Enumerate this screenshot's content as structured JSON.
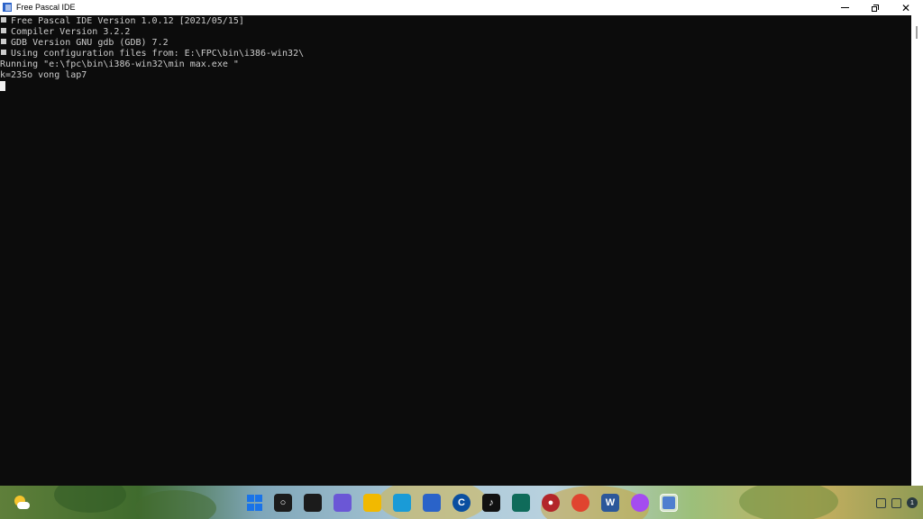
{
  "window": {
    "title": "Free Pascal IDE",
    "controls": {
      "minimize_icon": "minimize-icon",
      "restore_icon": "restore-icon",
      "close_icon": "close-icon",
      "close_glyph": "✕"
    }
  },
  "console": {
    "lines": [
      {
        "bullet": true,
        "text": "Free Pascal IDE Version 1.0.12 [2021/05/15]"
      },
      {
        "bullet": true,
        "text": "Compiler Version 3.2.2"
      },
      {
        "bullet": true,
        "text": "GDB Version GNU gdb (GDB) 7.2"
      },
      {
        "bullet": true,
        "text": "Using configuration files from: E:\\FPC\\bin\\i386-win32\\"
      },
      {
        "bullet": false,
        "text": "Running \"e:\\fpc\\bin\\i386-win32\\min max.exe \""
      },
      {
        "bullet": false,
        "text": "k=23So vong lap7"
      }
    ],
    "text_color": "#cccccc",
    "background_color": "#0c0c0c"
  },
  "taskbar": {
    "icons": [
      {
        "name": "weather-icon"
      },
      {
        "name": "start-icon",
        "color": "#1a73e8"
      },
      {
        "name": "search-icon",
        "color": "#1b1b1b",
        "glyph": "○"
      },
      {
        "name": "task-view-icon",
        "color": "#1b1b1b"
      },
      {
        "name": "meet-icon",
        "color": "#6b57d6"
      },
      {
        "name": "file-explorer-icon",
        "color": "#f2b900"
      },
      {
        "name": "edge-icon",
        "color": "#1a9bd7"
      },
      {
        "name": "store-icon",
        "color": "#2a63c9"
      },
      {
        "name": "cortana-icon",
        "color": "#0a4fa0",
        "glyph": "C"
      },
      {
        "name": "tiktok-icon",
        "color": "#111111",
        "glyph": "♪"
      },
      {
        "name": "app-icon",
        "color": "#0f6b5a"
      },
      {
        "name": "record-icon",
        "color": "#b3262a",
        "glyph": "●"
      },
      {
        "name": "chrome-icon",
        "color": "#e0442f"
      },
      {
        "name": "word-icon",
        "color": "#2b579a",
        "glyph": "W"
      },
      {
        "name": "messenger-icon",
        "color": "#a44cf0"
      },
      {
        "name": "free-pascal-icon",
        "color": "#4f7fcf",
        "active": true
      }
    ],
    "tray": {
      "notification_count": "1"
    }
  }
}
